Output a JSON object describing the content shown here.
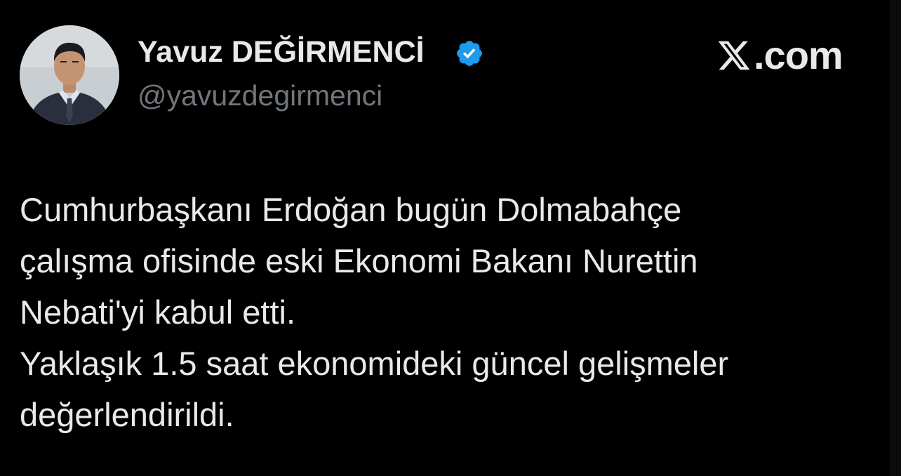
{
  "author": {
    "name": "Yavuz DEĞİRMENCİ",
    "handle": "@yavuzdegirmenci",
    "verified_icon": "verified-badge-icon",
    "verified_color": "#1d9bf0"
  },
  "brand": {
    "logo_icon": "x-logo-icon",
    "text": ".com"
  },
  "tweet": {
    "lines": [
      "Cumhurbaşkanı Erdoğan bugün Dolmabahçe",
      "çalışma ofisinde eski Ekonomi Bakanı Nurettin",
      "Nebati'yi kabul etti.",
      "Yaklaşık 1.5 saat ekonomideki güncel gelişmeler",
      "değerlendirildi."
    ]
  },
  "colors": {
    "background": "#000000",
    "primary_text": "#e7e9ea",
    "secondary_text": "#71767b"
  }
}
